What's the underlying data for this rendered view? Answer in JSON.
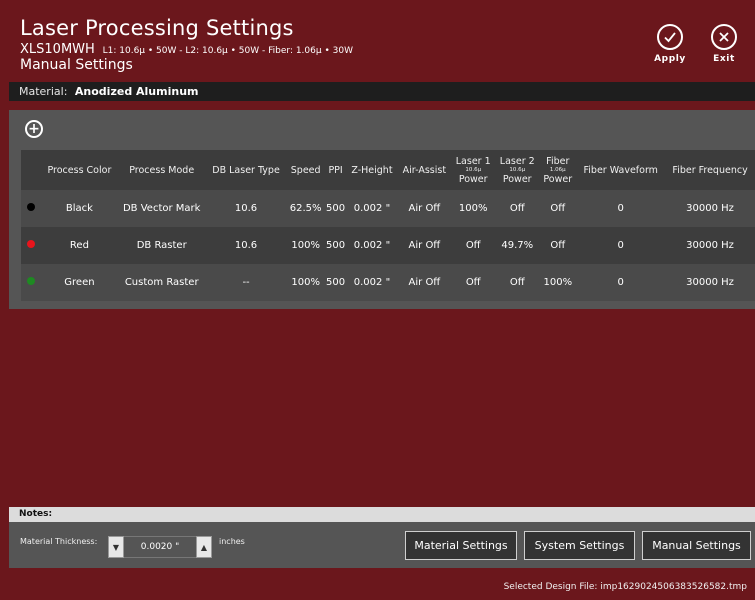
{
  "header": {
    "title": "Laser Processing Settings",
    "model": "XLS10MWH",
    "specs": "L1: 10.6μ • 50W - L2: 10.6μ • 50W - Fiber: 1.06μ • 30W",
    "mode": "Manual Settings",
    "apply_label": "Apply",
    "exit_label": "Exit"
  },
  "material": {
    "label": "Material:",
    "value": "Anodized Aluminum"
  },
  "table": {
    "headers": {
      "process_color": "Process Color",
      "process_mode": "Process Mode",
      "db_laser_type": "DB Laser Type",
      "speed": "Speed",
      "ppi": "PPI",
      "z_height": "Z-Height",
      "air_assist": "Air-Assist",
      "laser1_top": "Laser 1",
      "laser1_wave": "10.6μ",
      "laser1_bottom": "Power",
      "laser2_top": "Laser 2",
      "laser2_wave": "10.6μ",
      "laser2_bottom": "Power",
      "fiber_top": "Fiber",
      "fiber_wave": "1.06μ",
      "fiber_bottom": "Power",
      "fiber_waveform": "Fiber Waveform",
      "fiber_frequency": "Fiber Frequency"
    },
    "rows": [
      {
        "color_hex": "#000000",
        "color": "Black",
        "mode": "DB Vector Mark",
        "laser_type": "10.6",
        "speed": "62.5%",
        "ppi": "500",
        "z_height": "0.002 \"",
        "air": "Air Off",
        "l1": "100%",
        "l2": "Off",
        "fiber": "Off",
        "waveform": "0",
        "frequency": "30000 Hz"
      },
      {
        "color_hex": "#e8141c",
        "color": "Red",
        "mode": "DB Raster",
        "laser_type": "10.6",
        "speed": "100%",
        "ppi": "500",
        "z_height": "0.002 \"",
        "air": "Air Off",
        "l1": "Off",
        "l2": "49.7%",
        "fiber": "Off",
        "waveform": "0",
        "frequency": "30000 Hz"
      },
      {
        "color_hex": "#1e8a22",
        "color": "Green",
        "mode": "Custom Raster",
        "laser_type": "--",
        "speed": "100%",
        "ppi": "500",
        "z_height": "0.002 \"",
        "air": "Air Off",
        "l1": "Off",
        "l2": "Off",
        "fiber": "100%",
        "waveform": "0",
        "frequency": "30000 Hz"
      }
    ]
  },
  "notes": {
    "label": "Notes:"
  },
  "thickness": {
    "label": "Material Thickness:",
    "value": "0.0020 \"",
    "units": "inches",
    "down_glyph": "▼",
    "up_glyph": "▲"
  },
  "buttons": {
    "material_settings": "Material Settings",
    "system_settings": "System Settings",
    "manual_settings": "Manual Settings"
  },
  "status": {
    "label": "Selected Design File:",
    "file": "imp1629024506383526582.tmp"
  },
  "icons": {
    "apply": "check-circle-icon",
    "exit": "close-circle-icon",
    "add": "plus-circle-icon"
  },
  "colors": {
    "background": "#6b171c",
    "panel": "#555555",
    "header_row": "#3c3c3c"
  }
}
